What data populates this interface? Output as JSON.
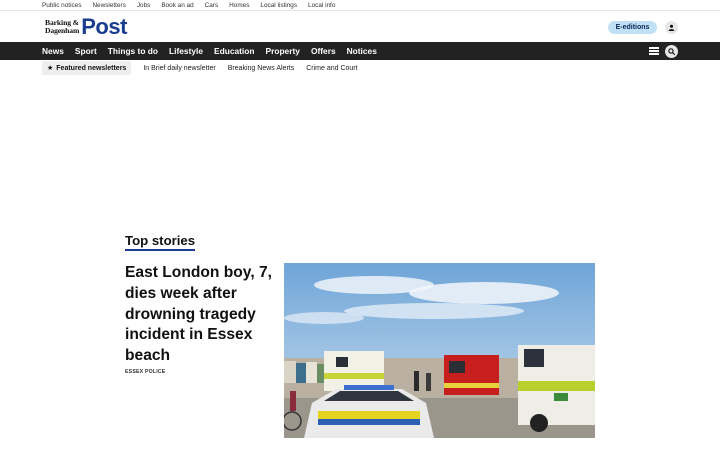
{
  "utility_bar": {
    "items": [
      "Public notices",
      "Newsletters",
      "Jobs",
      "Book an ad",
      "Cars",
      "Homes",
      "Local listings",
      "Local info"
    ]
  },
  "masthead": {
    "logo_line1": "Barking &",
    "logo_line2": "Dagenham",
    "logo_main": "Post",
    "eeditions_label": "E-editions",
    "brand_color": "#1a3d8f",
    "pill_color": "#bfe0f5"
  },
  "main_nav": {
    "items": [
      "News",
      "Sport",
      "Things to do",
      "Lifestyle",
      "Education",
      "Property",
      "Offers",
      "Notices"
    ],
    "background": "#222222"
  },
  "sub_nav": {
    "featured_label": "Featured newsletters",
    "links": [
      "In Brief daily newsletter",
      "Breaking News Alerts",
      "Crime and Court"
    ]
  },
  "top_stories": {
    "heading": "Top stories",
    "lead_story": {
      "headline": "East London boy, 7, dies week after drowning tragedy incident in Essex beach",
      "source": "ESSEX POLICE",
      "image_alt": "Emergency vehicles at an Essex beach"
    }
  }
}
